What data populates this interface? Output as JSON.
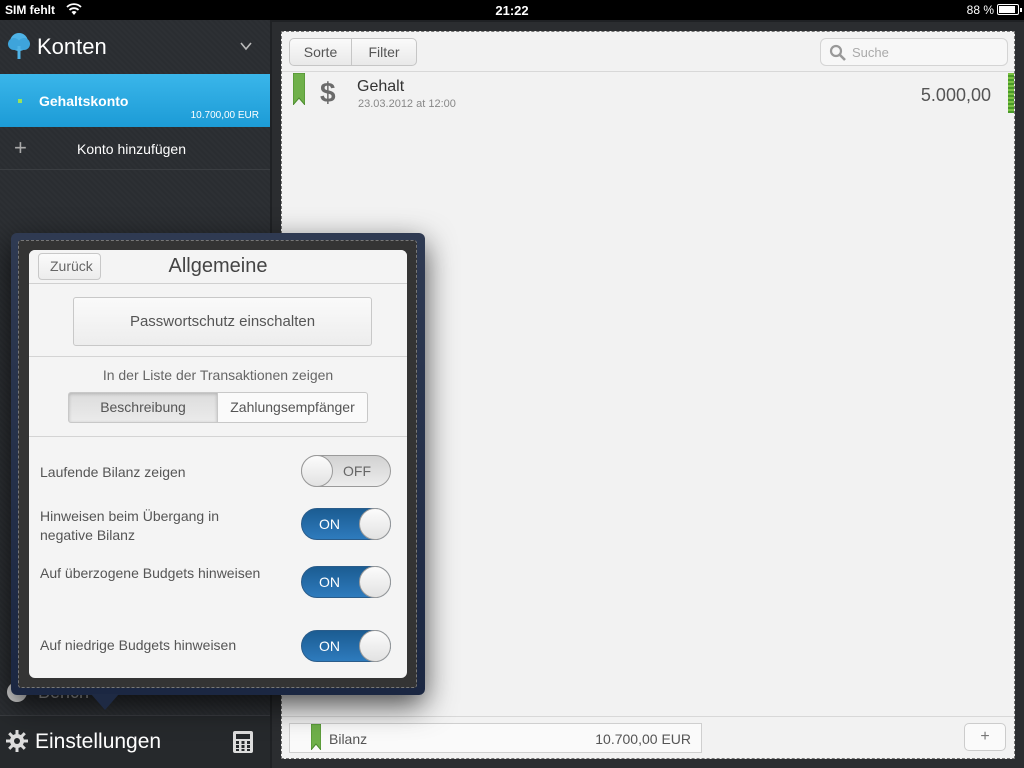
{
  "status_bar": {
    "carrier": "SIM fehlt",
    "time": "21:22",
    "battery": "88 %"
  },
  "sidebar": {
    "title": "Konten",
    "accounts": [
      {
        "name": "Gehaltskonto",
        "balance": "10.700,00 EUR"
      }
    ],
    "add_account_label": "Konto hinzufügen",
    "behind_popover_text": "Berich",
    "footer_label": "Einstellungen"
  },
  "toolbar": {
    "sort_label": "Sorte",
    "filter_label": "Filter",
    "search_placeholder": "Suche"
  },
  "transactions": [
    {
      "name": "Gehalt",
      "date": "23.03.2012 at 12:00",
      "amount": "5.000,00"
    }
  ],
  "bottom_bar": {
    "balance_label": "Bilanz",
    "balance_value": "10.700,00 EUR",
    "add_label": "+"
  },
  "popover": {
    "back_label": "Zurück",
    "title": "Allgemeine",
    "password_button": "Passwortschutz einschalten",
    "list_section_label": "In der Liste der Transaktionen zeigen",
    "segment_options": [
      "Beschreibung",
      "Zahlungsempfänger"
    ],
    "segment_selected": "Beschreibung",
    "settings": [
      {
        "label": "Laufende Bilanz zeigen",
        "state": "OFF"
      },
      {
        "label": "Hinweisen beim Übergang in negative Bilanz",
        "state": "ON"
      },
      {
        "label": "Auf überzogene Budgets hinweisen",
        "state": "ON"
      },
      {
        "label": "Auf niedrige Budgets hinweisen",
        "state": "ON"
      }
    ]
  },
  "colors": {
    "accent_blue": "#1c9bd6",
    "toggle_on": "#2e7bbd",
    "flag_green": "#6fb04a"
  },
  "icons": {
    "app_logo": "tree-icon",
    "dropdown": "chevron-down-icon",
    "search": "search-icon",
    "settings": "gear-icon",
    "calculator": "calculator-icon",
    "flag": "bookmark-flag-icon",
    "dollar": "dollar-icon"
  }
}
